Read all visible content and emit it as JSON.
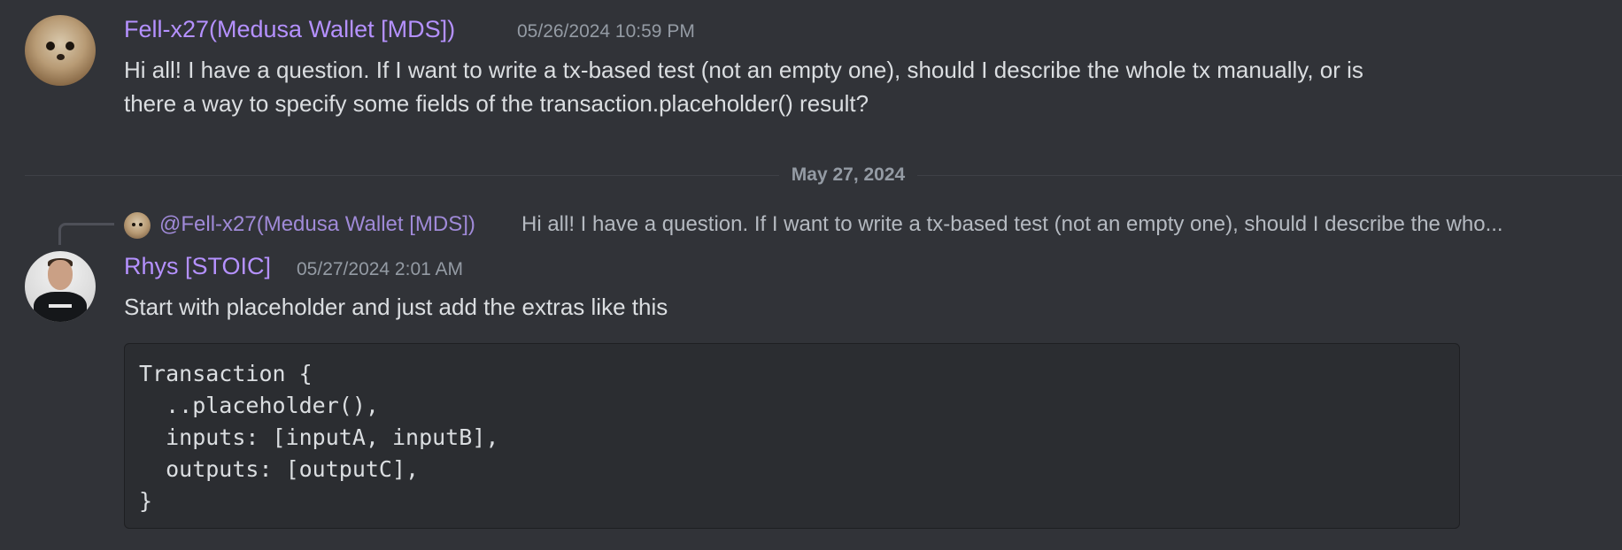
{
  "messages": [
    {
      "username": "Fell-x27(Medusa Wallet [MDS])",
      "timestamp": "05/26/2024 10:59 PM",
      "content_line1": "Hi all! I have a question. If I want to write a tx-based test (not an empty one), should I describe the whole tx manually, or is",
      "content_line2": "there a way to specify some fields of the transaction.placeholder() result?"
    },
    {
      "reply": {
        "mention": "@Fell-x27(Medusa Wallet [MDS])",
        "text": "Hi all! I have a question. If I want to write a tx-based test (not an empty one), should I describe the who..."
      },
      "username": "Rhys [STOIC]",
      "timestamp": "05/27/2024 2:01 AM",
      "content": "Start with placeholder and just add the extras like this",
      "code": "Transaction {\n  ..placeholder(),\n  inputs: [inputA, inputB],\n  outputs: [outputC],\n}"
    }
  ],
  "date_divider": "May 27, 2024",
  "colors": {
    "background": "#313338",
    "username": "#b591ff",
    "timestamp": "#949ba4",
    "text": "#dbdee1",
    "code_background": "#2b2d31"
  },
  "icons": [
    "meerkat-avatar",
    "profile-avatar",
    "reply-spine"
  ]
}
